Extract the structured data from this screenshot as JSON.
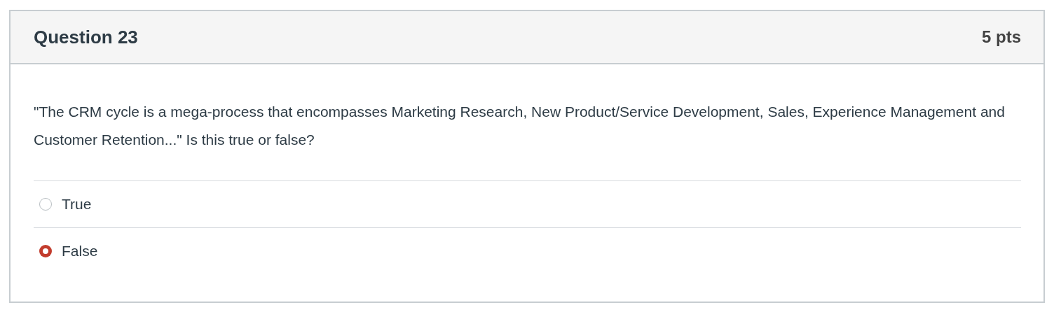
{
  "question": {
    "title": "Question 23",
    "points": "5 pts",
    "text": "\"The CRM cycle is a mega-process that encompasses Marketing Research, New Product/Service Development, Sales, Experience Management and Customer Retention...\" Is this true or false?"
  },
  "answers": [
    {
      "label": "True",
      "selected": false
    },
    {
      "label": "False",
      "selected": true
    }
  ]
}
